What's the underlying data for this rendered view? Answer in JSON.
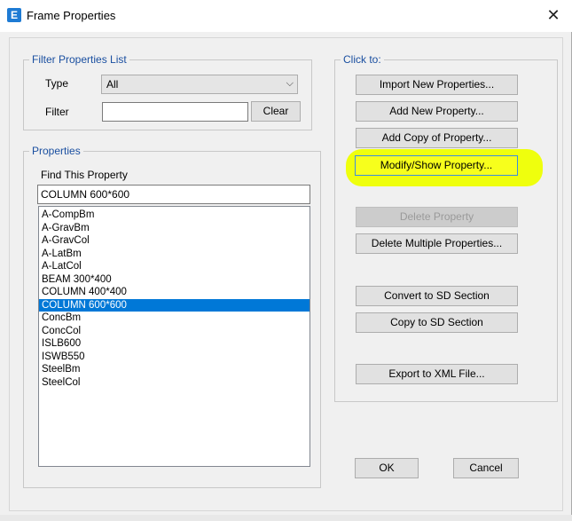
{
  "window": {
    "title": "Frame Properties",
    "app_icon_letter": "E",
    "close_glyph": "✕"
  },
  "filter_group": {
    "label": "Filter Properties List",
    "type_label": "Type",
    "type_value": "All",
    "filter_label": "Filter",
    "filter_value": "",
    "clear_button": "Clear"
  },
  "properties_group": {
    "label": "Properties",
    "find_label": "Find This Property",
    "find_value": "COLUMN 600*600",
    "items": [
      "A-CompBm",
      "A-GravBm",
      "A-GravCol",
      "A-LatBm",
      "A-LatCol",
      "BEAM 300*400",
      "COLUMN 400*400",
      "COLUMN 600*600",
      "ConcBm",
      "ConcCol",
      "ISLB600",
      "ISWB550",
      "SteelBm",
      "SteelCol"
    ],
    "selected_item": "COLUMN 600*600"
  },
  "click_to_group": {
    "label": "Click to:",
    "buttons": {
      "import": "Import New Properties...",
      "add_new": "Add New Property...",
      "add_copy": "Add Copy of Property...",
      "modify": "Modify/Show Property...",
      "delete": "Delete Property",
      "delete_multiple": "Delete Multiple Properties...",
      "convert_sd": "Convert to SD Section",
      "copy_sd": "Copy to SD Section",
      "export_xml": "Export to XML File..."
    }
  },
  "footer": {
    "ok": "OK",
    "cancel": "Cancel"
  },
  "colors": {
    "highlight": "#f7ff1c",
    "selection": "#0078d7",
    "group_label": "#1a4fa0"
  },
  "icons": {
    "app": "etabs-app-icon",
    "close": "close-icon",
    "dropdown": "chevron-down-icon"
  }
}
